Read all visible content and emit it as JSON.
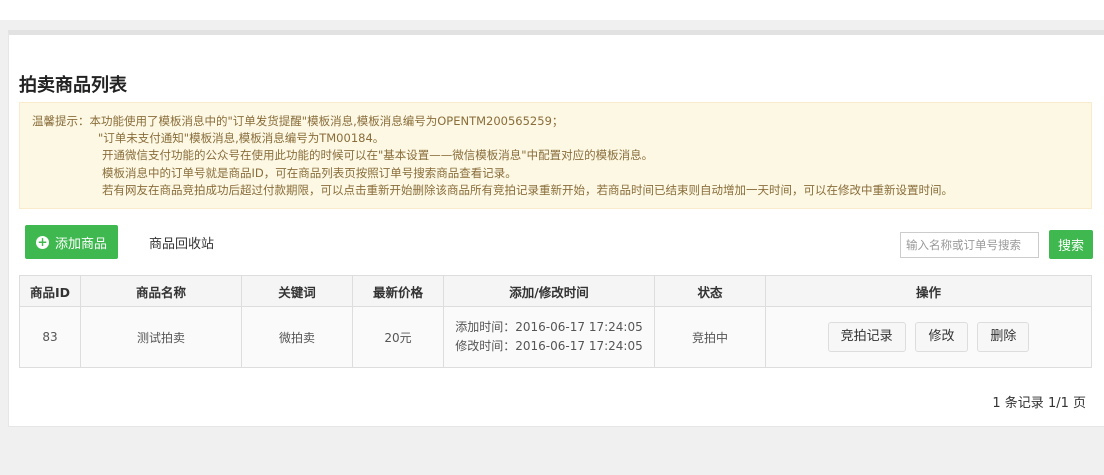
{
  "page": {
    "title": "拍卖商品列表"
  },
  "notice": {
    "lines": [
      "温馨提示：本功能使用了模板消息中的\"订单发货提醒\"模板消息,模板消息编号为OPENTM200565259；",
      "\"订单未支付通知\"模板消息,模板消息编号为TM00184。",
      "开通微信支付功能的公众号在使用此功能的时候可以在\"基本设置——微信模板消息\"中配置对应的模板消息。",
      "模板消息中的订单号就是商品ID，可在商品列表页按照订单号搜索商品查看记录。",
      "若有网友在商品竞拍成功后超过付款期限，可以点击重新开始删除该商品所有竞拍记录重新开始，若商品时间已结束则自动增加一天时间，可以在修改中重新设置时间。"
    ]
  },
  "toolbar": {
    "add_label": "添加商品",
    "recycle_label": "商品回收站",
    "search_placeholder": "输入名称或订单号搜索",
    "search_value": "",
    "search_label": "搜索"
  },
  "table": {
    "headers": [
      "商品ID",
      "商品名称",
      "关键词",
      "最新价格",
      "添加/修改时间",
      "状态",
      "操作"
    ],
    "rows": [
      {
        "id": "83",
        "name": "测试拍卖",
        "keyword": "微拍卖",
        "price": "20元",
        "added": "添加时间：2016-06-17 17:24:05",
        "modified": "修改时间：2016-06-17 17:24:05",
        "status": "竞拍中",
        "actions": [
          "竞拍记录",
          "修改",
          "删除"
        ]
      }
    ]
  },
  "pager": {
    "text": "1 条记录 1/1 页"
  },
  "colors": {
    "primary_green": "#3fb94f",
    "notice_bg": "#fcf8e3",
    "notice_text": "#8a6d3b",
    "status_green": "#3c8a2f"
  }
}
